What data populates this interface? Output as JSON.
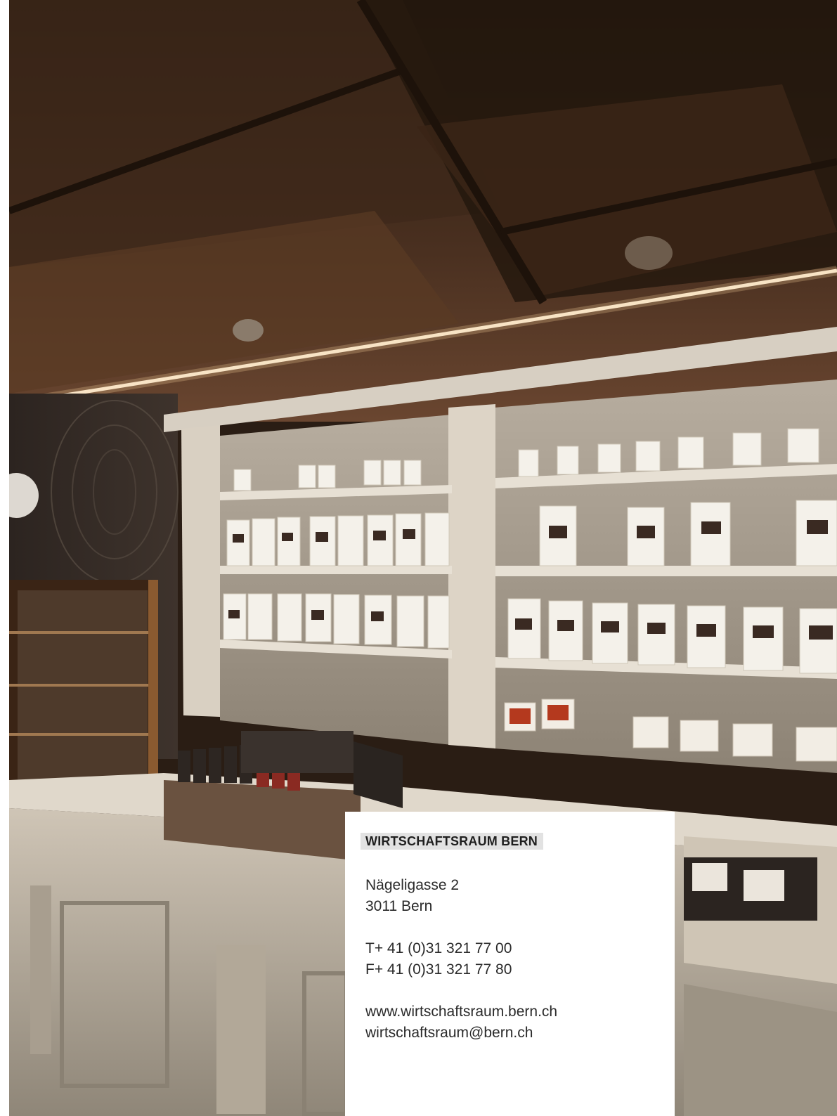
{
  "card": {
    "heading": "WIRTSCHAFTSRAUM BERN",
    "address": {
      "street": "Nägeligasse 2",
      "city": "3011 Bern"
    },
    "contact": {
      "phone": "T+ 41 (0)31 321 77 00",
      "fax": "F+ 41 (0)31 321 77 80"
    },
    "web": {
      "url": "www.wirtschaftsraum.bern.ch",
      "email": "wirtschaftsraum@bern.ch"
    }
  },
  "colors": {
    "ceiling_wood": "#3b2617",
    "shelf_cream": "#d9d0c2",
    "card_background": "#ffffff",
    "heading_highlight": "#e2e2e2",
    "text": "#2a2a2a"
  }
}
